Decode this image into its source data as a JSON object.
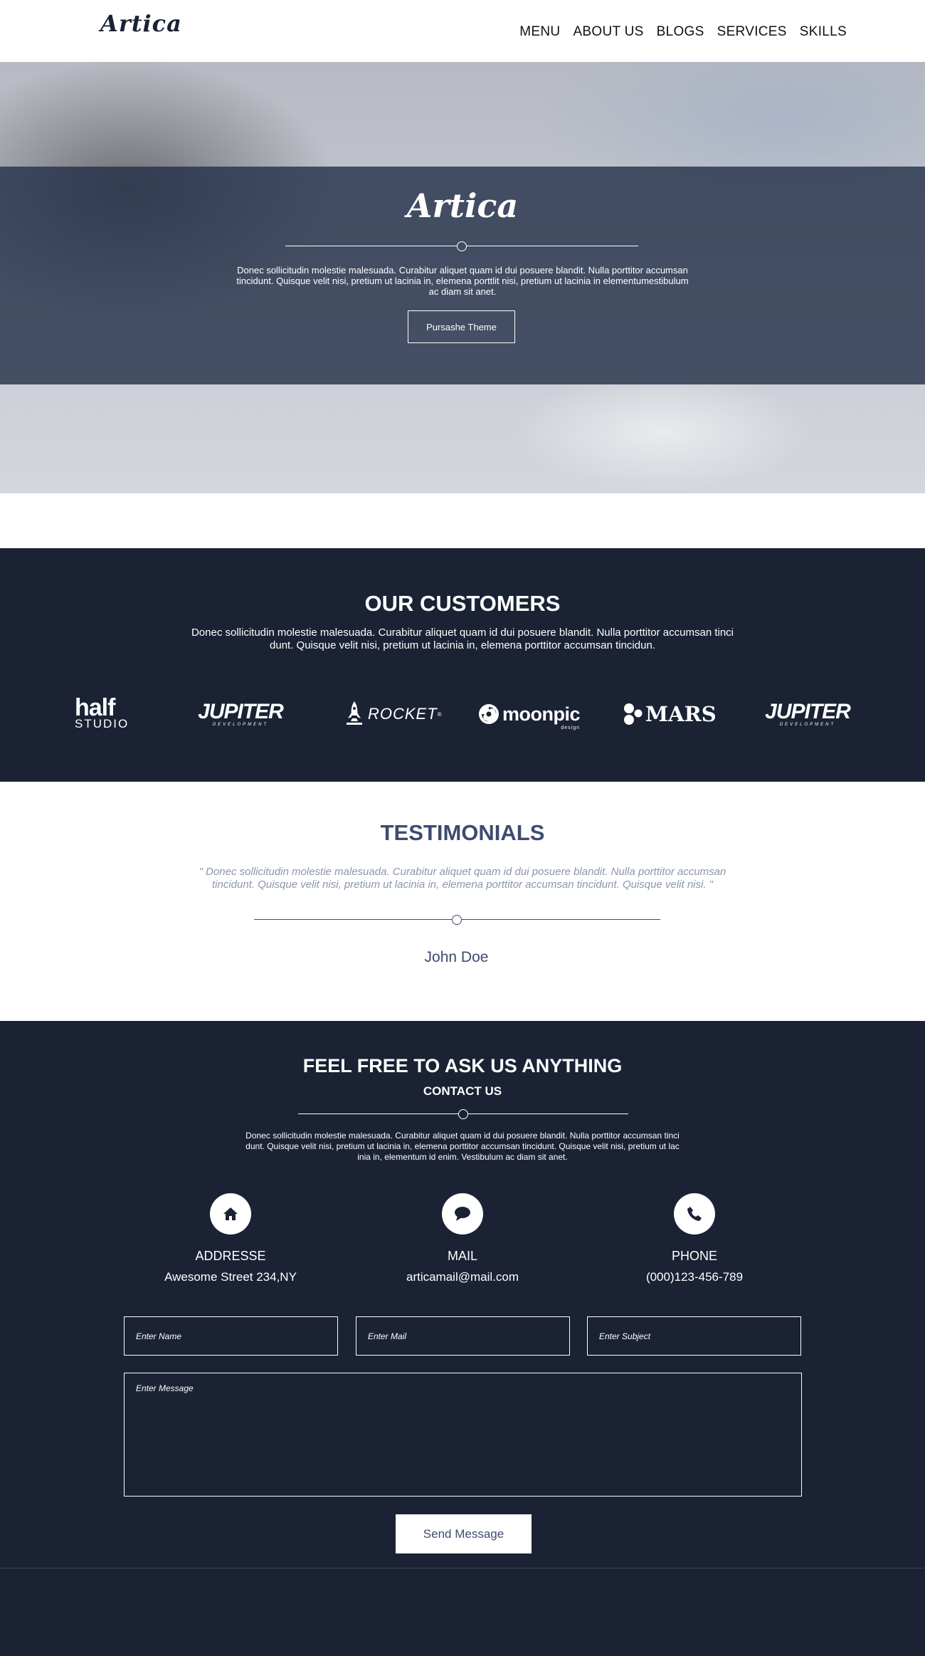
{
  "header": {
    "brand": "Artica",
    "nav": [
      "MENU",
      "ABOUT US",
      "BLOGS",
      "SERVICES",
      "SKILLS"
    ]
  },
  "hero": {
    "logo": "Artica",
    "text": "Donec sollicitudin molestie malesuada. Curabitur aliquet quam id dui posuere blandit. Nulla porttitor accumsan tincidunt. Quisque velit nisi, pretium ut lacinia in, elemena porttlit nisi, pretium ut lacinia in elementumestibulum ac diam sit anet.",
    "button": "Pursashe Theme"
  },
  "customers": {
    "title": "OUR CUSTOMERS",
    "text": "Donec sollicitudin molestie malesuada. Curabitur aliquet quam id dui posuere blandit. Nulla porttitor accumsan tinci dunt. Quisque velit nisi, pretium ut lacinia in, elemena porttitor accumsan tincidun.",
    "logos": {
      "half_a": "half",
      "half_b": "STUDIO",
      "jupiter_a": "JUPITER",
      "jupiter_b": "DEVELOPMENT",
      "rocket": "ROCKET",
      "rocket_mark": "®",
      "moonpic": "moonpic",
      "moonpic_sub": "design",
      "mars": "MARS"
    }
  },
  "testimonials": {
    "title": "TESTIMONIALS",
    "quote": "\" Donec sollicitudin molestie malesuada. Curabitur aliquet quam id dui posuere blandit. Nulla porttitor accumsan tincidunt. Quisque velit nisi, pretium ut lacinia in, elemena porttitor accumsan tincidunt. Quisque velit nisi. \"",
    "author": "John Doe"
  },
  "contact": {
    "title": "FEEL FREE TO ASK US ANYTHING",
    "subtitle": "CONTACT US",
    "intro": "Donec sollicitudin molestie malesuada. Curabitur aliquet quam id dui posuere blandit. Nulla porttitor accumsan tinci dunt. Quisque velit nisi, pretium ut lacinia in, elemena porttitor accumsan tincidunt. Quisque velit nisi, pretium ut lac inia in, elementum id enim. Vestibulum ac diam sit anet.",
    "address_label": "ADDRESSE",
    "address_value": "Awesome Street 234,NY",
    "mail_label": "MAIL",
    "mail_value": "articamail@mail.com",
    "phone_label": "PHONE",
    "phone_value": "(000)123-456-789",
    "name_placeholder": "Enter Name",
    "mail_placeholder": "Enter Mail",
    "subject_placeholder": "Enter Subject",
    "message_placeholder": "Enter Message",
    "send_button": "Send Message"
  },
  "icons": {
    "address": "home-icon",
    "mail": "chat-bubble-icon",
    "phone": "phone-icon"
  },
  "colors": {
    "navy": "#1a2234",
    "accent": "#3d4c70",
    "muted": "#8a95ad",
    "white": "#ffffff"
  }
}
